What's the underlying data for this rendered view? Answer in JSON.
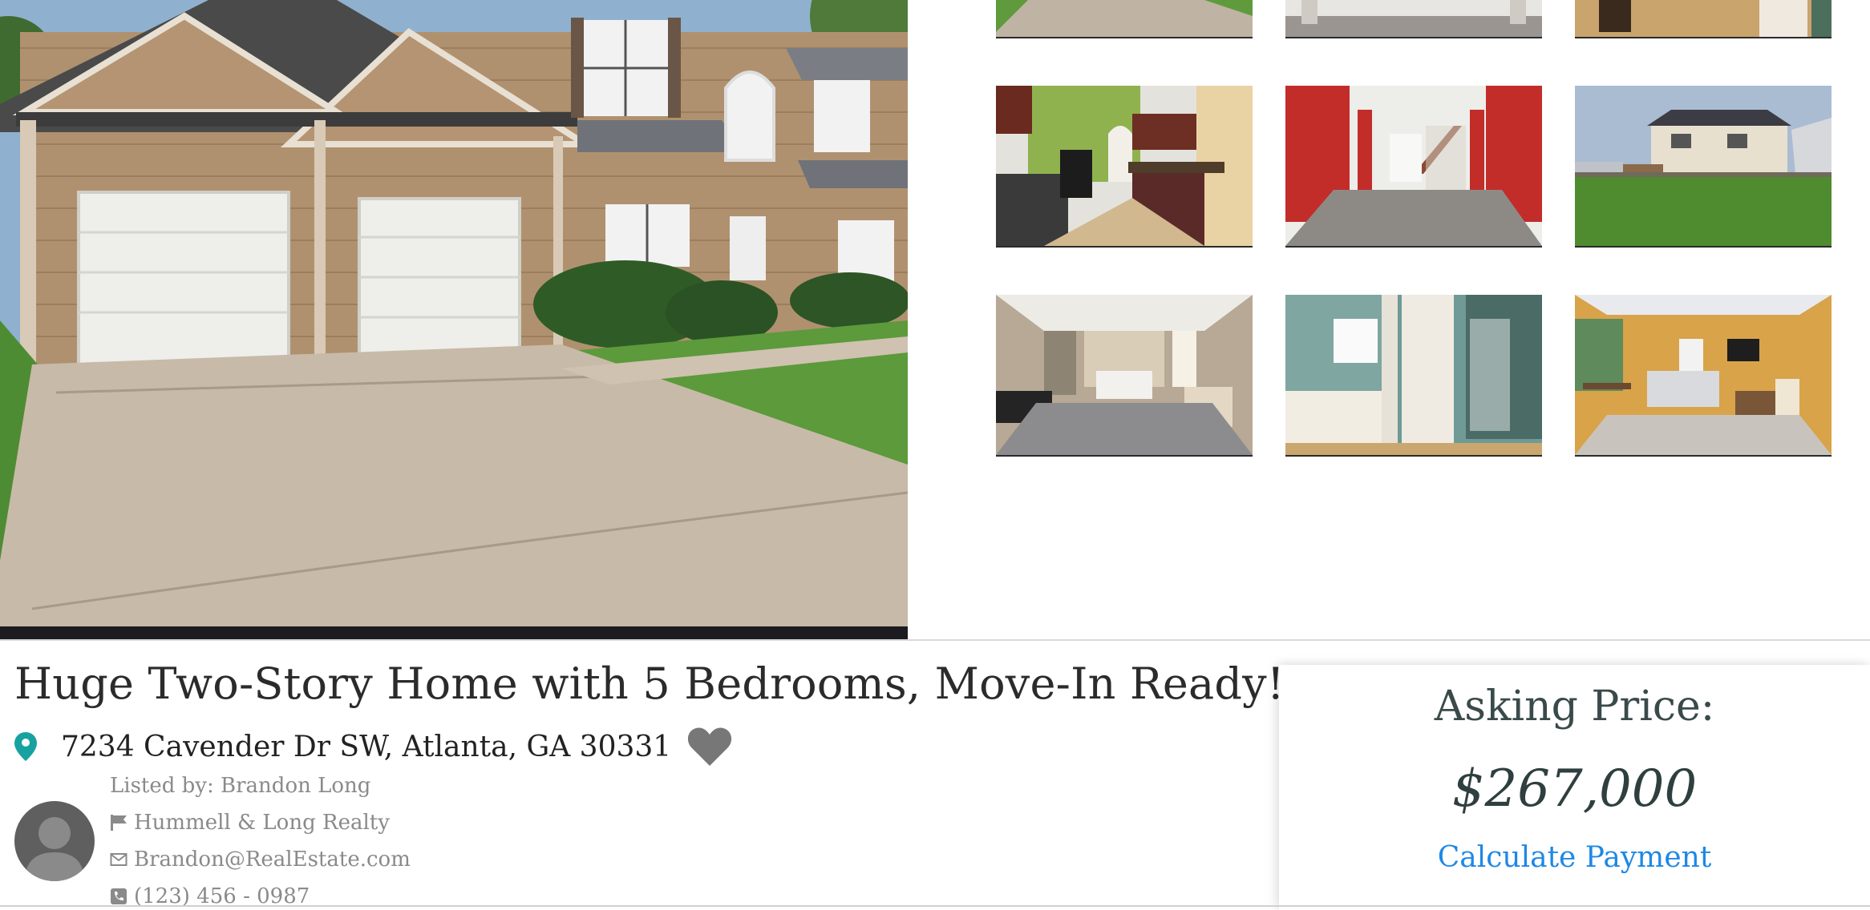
{
  "listing": {
    "title": "Huge Two-Story Home with 5 Bedrooms, Move-In Ready!",
    "address": "7234 Cavender Dr SW, Atlanta, GA 30331",
    "favorite_icon": "heart-icon",
    "location_icon": "map-pin-icon"
  },
  "agent": {
    "listed_by": "Listed by: Brandon Long",
    "company": "Hummell & Long Realty",
    "email": "Brandon@RealEstate.com",
    "phone": "(123) 456 - 0987",
    "icons": [
      "flag-icon",
      "envelope-icon",
      "phone-icon"
    ]
  },
  "price_card": {
    "label": "Asking Price:",
    "price": "$267,000",
    "link": "Calculate Payment"
  },
  "gallery": {
    "main_photo": "house-exterior-front",
    "thumbnails": [
      "driveway",
      "living-room-empty",
      "hallway-wood-floor",
      "kitchen",
      "red-living-room-staircase",
      "backyard-rear-exterior",
      "bedroom-staged",
      "bathroom-tub-shower",
      "living-dining-staged"
    ]
  },
  "colors": {
    "pin": "#17a2a0",
    "link": "#1e88e5",
    "heart": "#777777",
    "text_muted": "#8a8a8a"
  }
}
